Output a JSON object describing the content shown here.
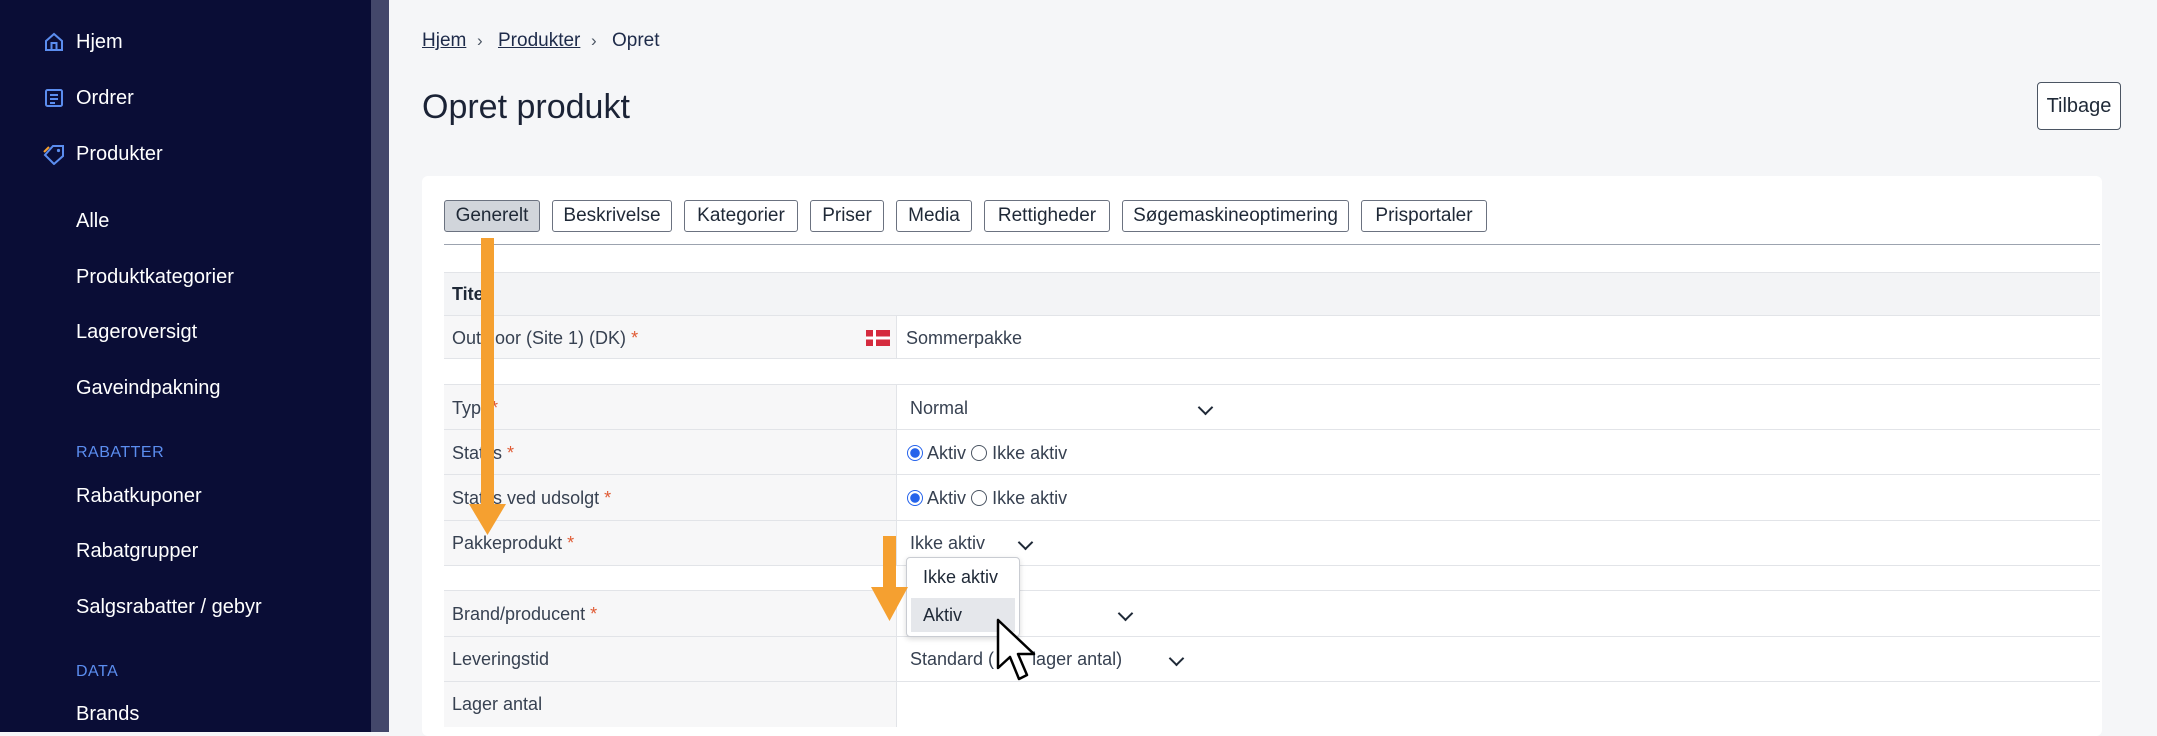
{
  "sidebar": {
    "top_items": [
      {
        "label": "Hjem",
        "icon": "home-icon"
      },
      {
        "label": "Ordrer",
        "icon": "orders-icon"
      },
      {
        "label": "Produkter",
        "icon": "tag-icon"
      }
    ],
    "sub_items": [
      "Alle",
      "Produktkategorier",
      "Lageroversigt",
      "Gaveindpakning"
    ],
    "section_rabatter": "RABATTER",
    "rabatter_items": [
      "Rabatkuponer",
      "Rabatgrupper",
      "Salgsrabatter / gebyr"
    ],
    "section_data": "DATA",
    "data_items": [
      "Brands"
    ]
  },
  "breadcrumb": {
    "items": [
      "Hjem",
      "Produkter",
      "Opret"
    ],
    "separator": "›"
  },
  "page": {
    "title": "Opret produkt",
    "back_label": "Tilbage"
  },
  "tabs": [
    "Generelt",
    "Beskrivelse",
    "Kategorier",
    "Priser",
    "Media",
    "Rettigheder",
    "Søgemaskineoptimering",
    "Prisportaler"
  ],
  "active_tab": "Generelt",
  "form": {
    "title_section": "Titel",
    "title_section_visible": "Tite",
    "site_label": "Outdoor (Site 1) (DK)",
    "site_label_visible": [
      "Out",
      "oor (Site 1) (DK)"
    ],
    "site_value": "Sommerpakke",
    "type_label": "Type",
    "type_label_visible": "Type",
    "type_value": "Normal",
    "status_label_visible": [
      "Stat",
      "s"
    ],
    "status_options": [
      "Aktiv",
      "Ikke aktiv"
    ],
    "status_sold_label_visible": [
      "Stat",
      "s ved udsolgt"
    ],
    "status_sold_options": [
      "Aktiv",
      "Ikke aktiv"
    ],
    "package_label_visible": [
      "Pak",
      "keprodukt"
    ],
    "package_value": "Ikke aktiv",
    "brand_label": "Brand/producent",
    "delivery_label": "Leveringstid",
    "delivery_value_visible": [
      "Standard (",
      "lager antal)"
    ],
    "stock_label": "Lager antal",
    "required_mark": "*"
  },
  "dropdown": {
    "options": [
      "Ikke aktiv",
      "Aktiv"
    ],
    "highlighted": "Aktiv"
  },
  "colors": {
    "sidebar_bg": "#0a0d36",
    "accent_arrow": "#f5a030",
    "required": "#e05a33",
    "radio_on": "#2563eb",
    "section_head": "#5b8def"
  }
}
